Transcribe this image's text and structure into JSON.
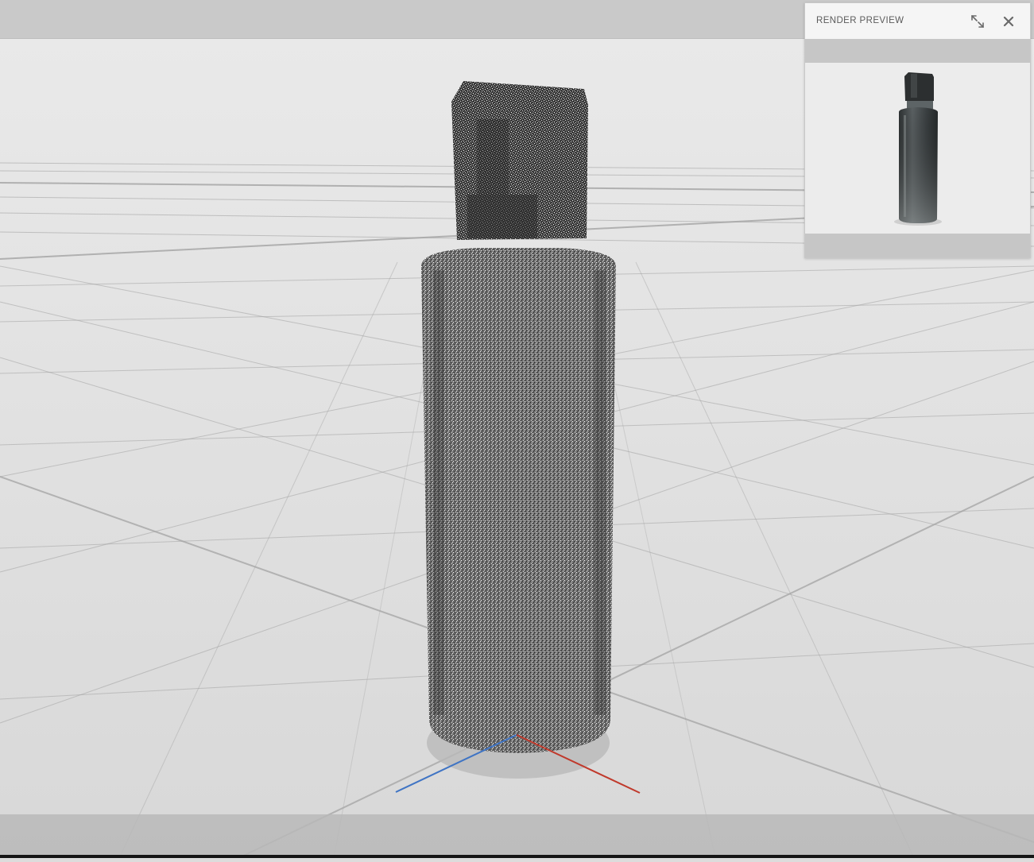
{
  "viewport": {
    "background_color": "#dcdcdc",
    "grid_color": "#9a9a9a",
    "object": "plastic-bottle-with-flip-cap",
    "render_state": "noisy-progressive",
    "axes": {
      "x_color": "#c0392b",
      "z_color": "#3f74c4"
    }
  },
  "render_preview": {
    "title": "RENDER PREVIEW",
    "expand_icon": "expand-arrows-icon",
    "close_icon": "close-x-icon"
  }
}
